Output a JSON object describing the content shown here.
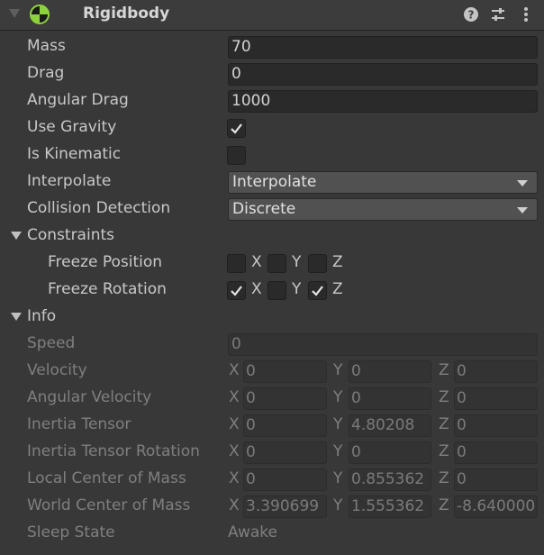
{
  "component": {
    "title": "Rigidbody",
    "icon": "rigidbody-icon",
    "accent_color": "#8cd23c"
  },
  "fields": {
    "mass": {
      "label": "Mass",
      "value": "70"
    },
    "drag": {
      "label": "Drag",
      "value": "0"
    },
    "angular_drag": {
      "label": "Angular Drag",
      "value": "1000"
    },
    "use_gravity": {
      "label": "Use Gravity",
      "checked": true
    },
    "is_kinematic": {
      "label": "Is Kinematic",
      "checked": false
    },
    "interpolate": {
      "label": "Interpolate",
      "value": "Interpolate"
    },
    "collision_detection": {
      "label": "Collision Detection",
      "value": "Discrete"
    }
  },
  "constraints": {
    "label": "Constraints",
    "freeze_position": {
      "label": "Freeze Position",
      "x": false,
      "y": false,
      "z": false
    },
    "freeze_rotation": {
      "label": "Freeze Rotation",
      "x": true,
      "y": false,
      "z": true
    },
    "axis_labels": {
      "x": "X",
      "y": "Y",
      "z": "Z"
    }
  },
  "info": {
    "label": "Info",
    "speed": {
      "label": "Speed",
      "value": "0"
    },
    "velocity": {
      "label": "Velocity",
      "x": "0",
      "y": "0",
      "z": "0"
    },
    "angular_velocity": {
      "label": "Angular Velocity",
      "x": "0",
      "y": "0",
      "z": "0"
    },
    "inertia_tensor": {
      "label": "Inertia Tensor",
      "x": "0",
      "y": "4.80208",
      "z": "0"
    },
    "inertia_tensor_rotation": {
      "label": "Inertia Tensor Rotation",
      "x": "0",
      "y": "0",
      "z": "0"
    },
    "local_center_of_mass": {
      "label": "Local Center of Mass",
      "x": "0",
      "y": "0.855362",
      "z": "0"
    },
    "world_center_of_mass": {
      "label": "World Center of Mass",
      "x": "3.390699",
      "y": "1.555362",
      "z": "-8.640000"
    },
    "sleep_state": {
      "label": "Sleep State",
      "value": "Awake"
    }
  }
}
